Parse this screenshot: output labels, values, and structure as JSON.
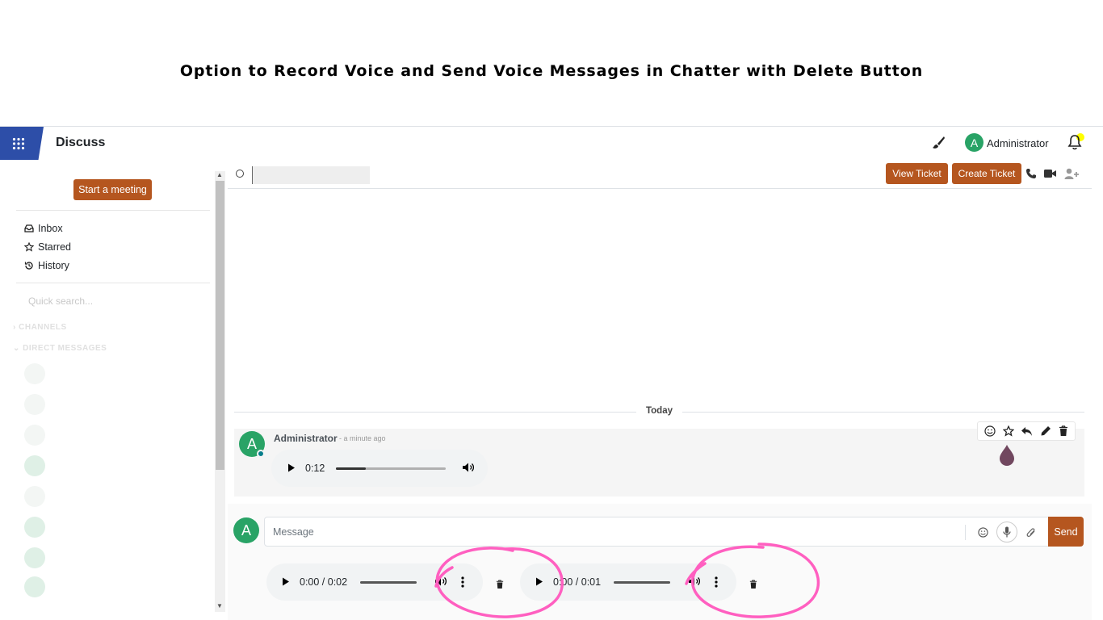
{
  "caption": "Option to Record Voice and Send Voice Messages in Chatter with Delete Button",
  "navbar": {
    "app_name": "Discuss",
    "user_initial": "A",
    "user_name": "Administrator",
    "icons": [
      "apps-grid-icon",
      "paint-brush-icon",
      "bell-icon"
    ]
  },
  "sidebar": {
    "start_meeting_label": "Start a meeting",
    "mailboxes": [
      {
        "label": "Inbox",
        "icon": "inbox-icon"
      },
      {
        "label": "Starred",
        "icon": "star-icon"
      },
      {
        "label": "History",
        "icon": "history-icon"
      }
    ],
    "quick_search_placeholder": "Quick search...",
    "categories": [
      "CHANNELS",
      "DIRECT MESSAGES"
    ]
  },
  "thread_header": {
    "view_ticket_label": "View Ticket",
    "create_ticket_label": "Create Ticket",
    "icons": [
      "phone-icon",
      "video-camera-icon",
      "add-user-icon"
    ]
  },
  "separator": {
    "label": "Today"
  },
  "message": {
    "author_initial": "A",
    "author": "Administrator",
    "time": "- a minute ago",
    "audio": {
      "time": "0:12",
      "progress": 0.27
    },
    "actions": [
      "emoji-icon",
      "star-icon",
      "reply-icon",
      "edit-icon",
      "trash-icon"
    ]
  },
  "composer": {
    "avatar_initial": "A",
    "placeholder": "Message",
    "send_label": "Send",
    "recordings": [
      {
        "time": "0:00 / 0:02",
        "progress": 0
      },
      {
        "time": "0:00 / 0:01",
        "progress": 0
      }
    ]
  },
  "colors": {
    "brand_orange": "#b5561f",
    "apps_blue": "#2d4ea8",
    "avatar_green": "#29a366",
    "annotation_pink": "#ff5fc0",
    "notification_yellow": "#ffff00"
  }
}
